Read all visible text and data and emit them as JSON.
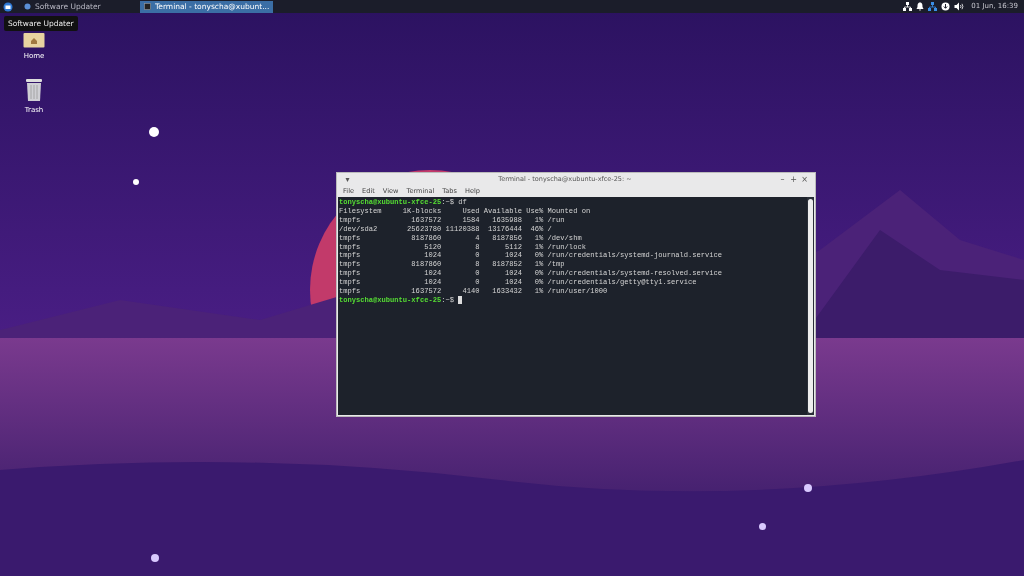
{
  "panel": {
    "tasks": [
      {
        "label": "Software Updater",
        "selected": false
      },
      {
        "label": "Terminal - tonyscha@xubunt...",
        "selected": true
      }
    ],
    "clock": "01 Jun, 16:39"
  },
  "tooltip": "Software Updater",
  "desktop_icons": [
    {
      "label": "Home",
      "kind": "folder"
    },
    {
      "label": "Trash",
      "kind": "trash"
    }
  ],
  "terminal": {
    "window_menu": "▾",
    "title": "Terminal - tonyscha@xubuntu-xfce-25: ~",
    "controls": [
      "–",
      "+",
      "×"
    ],
    "menu": [
      "File",
      "Edit",
      "View",
      "Terminal",
      "Tabs",
      "Help"
    ],
    "lines": [
      {
        "kind": "prompt",
        "user_host": "tonyscha@xubuntu-xfce-25",
        "path": ":~$ ",
        "command": "df",
        "cursor": false
      },
      {
        "kind": "output",
        "text": "Filesystem     1K-blocks     Used Available Use% Mounted on"
      },
      {
        "kind": "output",
        "text": "tmpfs            1637572     1584   1635988   1% /run"
      },
      {
        "kind": "output",
        "text": "/dev/sda2       25623780 11120388  13176444  46% /"
      },
      {
        "kind": "output",
        "text": "tmpfs            8187860        4   8187856   1% /dev/shm"
      },
      {
        "kind": "output",
        "text": "tmpfs               5120        8      5112   1% /run/lock"
      },
      {
        "kind": "output",
        "text": "tmpfs               1024        0      1024   0% /run/credentials/systemd-journald.service"
      },
      {
        "kind": "output",
        "text": "tmpfs            8187860        8   8187852   1% /tmp"
      },
      {
        "kind": "output",
        "text": "tmpfs               1024        0      1024   0% /run/credentials/systemd-resolved.service"
      },
      {
        "kind": "output",
        "text": "tmpfs               1024        0      1024   0% /run/credentials/getty@tty1.service"
      },
      {
        "kind": "output",
        "text": "tmpfs            1637572     4140   1633432   1% /run/user/1000"
      },
      {
        "kind": "prompt",
        "user_host": "tonyscha@xubuntu-xfce-25",
        "path": ":~$ ",
        "cursor": true
      }
    ]
  }
}
